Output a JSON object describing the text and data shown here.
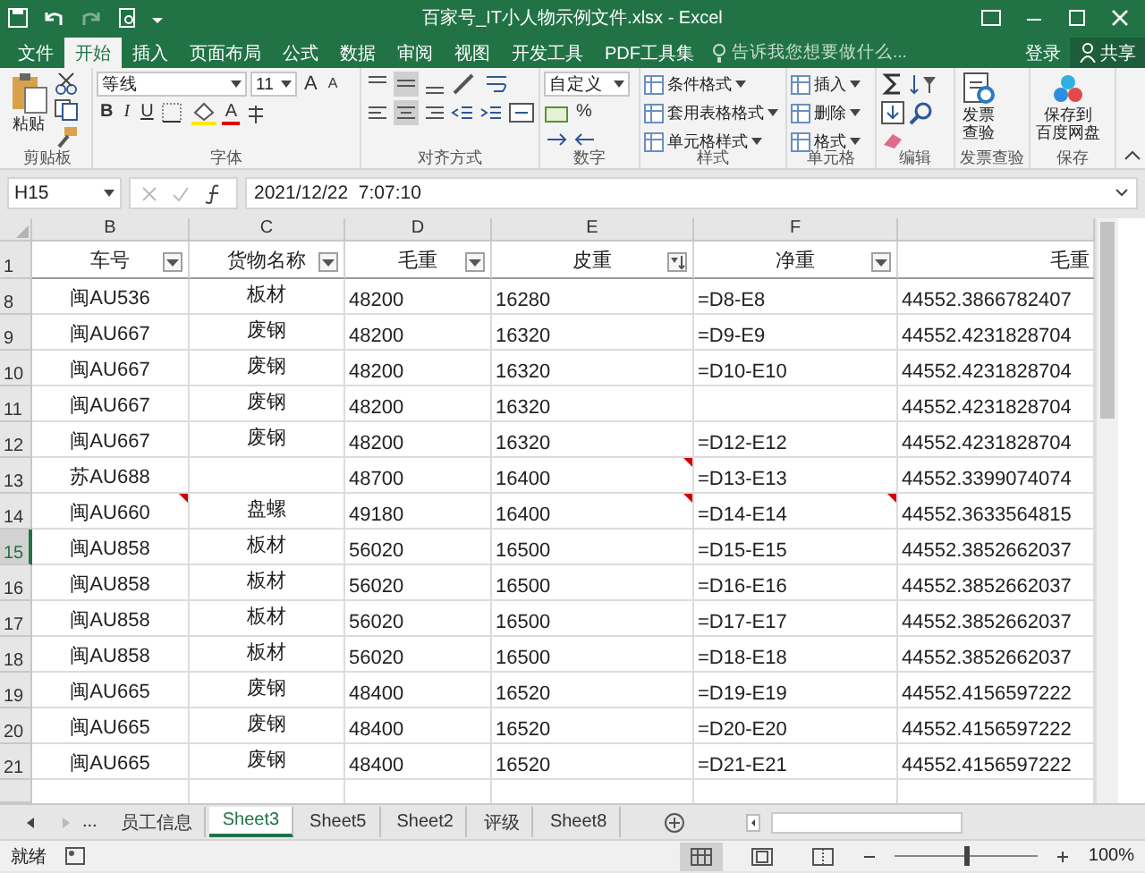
{
  "window": {
    "title": "百家号_IT小人物示例文件.xlsx - Excel"
  },
  "ribbon_tabs": [
    {
      "label": "文件",
      "selected": false
    },
    {
      "label": "开始",
      "selected": true
    },
    {
      "label": "插入",
      "selected": false
    },
    {
      "label": "页面布局",
      "selected": false
    },
    {
      "label": "公式",
      "selected": false
    },
    {
      "label": "数据",
      "selected": false
    },
    {
      "label": "审阅",
      "selected": false
    },
    {
      "label": "视图",
      "selected": false
    },
    {
      "label": "开发工具",
      "selected": false
    },
    {
      "label": "PDF工具集",
      "selected": false
    }
  ],
  "tell_me": {
    "placeholder": "告诉我您想要做什么..."
  },
  "sign_in": "登录",
  "share": "共享",
  "ribbon": {
    "groups": [
      {
        "kind": "clipboard",
        "label": "剪贴板",
        "paste": "粘贴"
      },
      {
        "kind": "font",
        "label": "字体",
        "font_name": "等线",
        "font_size": "11",
        "size_buttons": [
          "A",
          "A"
        ],
        "format_buttons": [
          "B",
          "I",
          "U"
        ],
        "font_color": "A"
      },
      {
        "kind": "align",
        "label": "对齐方式"
      },
      {
        "kind": "number",
        "label": "数字",
        "format": "自定义",
        "percent": "%"
      },
      {
        "kind": "commands",
        "label": "样式",
        "commands": [
          "条件格式",
          "套用表格格式",
          "单元格样式"
        ]
      },
      {
        "kind": "commands",
        "label": "单元格",
        "commands": [
          "插入",
          "删除",
          "格式"
        ]
      },
      {
        "kind": "editing",
        "label": "编辑"
      },
      {
        "kind": "big",
        "label": "发票查验",
        "lines": [
          "发票",
          "查验"
        ]
      },
      {
        "kind": "big",
        "label": "保存",
        "lines": [
          "保存到",
          "百度网盘"
        ]
      }
    ]
  },
  "formula_bar": {
    "name_box": "H15",
    "formula": "2021/12/22  7:07:10"
  },
  "header_row_number": "1",
  "columns": [
    {
      "letter": "B",
      "label": "车号",
      "filter_button": true,
      "sorted": false
    },
    {
      "letter": "C",
      "label": "货物名称",
      "filter_button": true,
      "sorted": false
    },
    {
      "letter": "D",
      "label": "毛重",
      "filter_button": true,
      "sorted": false
    },
    {
      "letter": "E",
      "label": "皮重",
      "filter_button": true,
      "sorted": true
    },
    {
      "letter": "F",
      "label": "净重",
      "filter_button": true,
      "sorted": false
    },
    {
      "label": "毛重",
      "filter_button": false
    }
  ],
  "rows": [
    {
      "number": "8",
      "selected": false,
      "cells": [
        {
          "text": "闽AU536",
          "comment": false
        },
        {
          "text": "板材",
          "comment": false
        },
        {
          "text": "48200",
          "comment": false
        },
        {
          "text": "16280",
          "comment": false
        },
        {
          "text": "=D8-E8",
          "comment": false
        },
        {
          "text": "44552.3866782407",
          "comment": false
        }
      ]
    },
    {
      "number": "9",
      "selected": false,
      "cells": [
        {
          "text": "闽AU667",
          "comment": false
        },
        {
          "text": "废钢",
          "comment": false
        },
        {
          "text": "48200",
          "comment": false
        },
        {
          "text": "16320",
          "comment": false
        },
        {
          "text": "=D9-E9",
          "comment": false
        },
        {
          "text": "44552.4231828704",
          "comment": false
        }
      ]
    },
    {
      "number": "10",
      "selected": false,
      "cells": [
        {
          "text": "闽AU667",
          "comment": false
        },
        {
          "text": "废钢",
          "comment": false
        },
        {
          "text": "48200",
          "comment": false
        },
        {
          "text": "16320",
          "comment": false
        },
        {
          "text": "=D10-E10",
          "comment": false
        },
        {
          "text": "44552.4231828704",
          "comment": false
        }
      ]
    },
    {
      "number": "11",
      "selected": false,
      "cells": [
        {
          "text": "闽AU667",
          "comment": false
        },
        {
          "text": "废钢",
          "comment": false
        },
        {
          "text": "48200",
          "comment": false
        },
        {
          "text": "16320",
          "comment": false
        },
        {
          "comment": false
        },
        {
          "text": "44552.4231828704",
          "comment": false
        }
      ]
    },
    {
      "number": "12",
      "selected": false,
      "cells": [
        {
          "text": "闽AU667",
          "comment": false
        },
        {
          "text": "废钢",
          "comment": false
        },
        {
          "text": "48200",
          "comment": false
        },
        {
          "text": "16320",
          "comment": false
        },
        {
          "text": "=D12-E12",
          "comment": false
        },
        {
          "text": "44552.4231828704",
          "comment": false
        }
      ]
    },
    {
      "number": "13",
      "selected": false,
      "cells": [
        {
          "text": "苏AU688",
          "comment": false
        },
        {
          "comment": false
        },
        {
          "text": "48700",
          "comment": false
        },
        {
          "text": "16400",
          "comment": true
        },
        {
          "text": "=D13-E13",
          "comment": false
        },
        {
          "text": "44552.3399074074",
          "comment": false
        }
      ]
    },
    {
      "number": "14",
      "selected": false,
      "cells": [
        {
          "text": "闽AU660",
          "comment": true
        },
        {
          "text": "盘螺",
          "comment": false
        },
        {
          "text": "49180",
          "comment": false
        },
        {
          "text": "16400",
          "comment": true
        },
        {
          "text": "=D14-E14",
          "comment": true
        },
        {
          "text": "44552.3633564815",
          "comment": false
        }
      ]
    },
    {
      "number": "15",
      "selected": true,
      "cells": [
        {
          "text": "闽AU858",
          "comment": false
        },
        {
          "text": "板材",
          "comment": false
        },
        {
          "text": "56020",
          "comment": false
        },
        {
          "text": "16500",
          "comment": false
        },
        {
          "text": "=D15-E15",
          "comment": false
        },
        {
          "text": "44552.3852662037",
          "comment": false
        }
      ]
    },
    {
      "number": "16",
      "selected": false,
      "cells": [
        {
          "text": "闽AU858",
          "comment": false
        },
        {
          "text": "板材",
          "comment": false
        },
        {
          "text": "56020",
          "comment": false
        },
        {
          "text": "16500",
          "comment": false
        },
        {
          "text": "=D16-E16",
          "comment": false
        },
        {
          "text": "44552.3852662037",
          "comment": false
        }
      ]
    },
    {
      "number": "17",
      "selected": false,
      "cells": [
        {
          "text": "闽AU858",
          "comment": false
        },
        {
          "text": "板材",
          "comment": false
        },
        {
          "text": "56020",
          "comment": false
        },
        {
          "text": "16500",
          "comment": false
        },
        {
          "text": "=D17-E17",
          "comment": false
        },
        {
          "text": "44552.3852662037",
          "comment": false
        }
      ]
    },
    {
      "number": "18",
      "selected": false,
      "cells": [
        {
          "text": "闽AU858",
          "comment": false
        },
        {
          "text": "板材",
          "comment": false
        },
        {
          "text": "56020",
          "comment": false
        },
        {
          "text": "16500",
          "comment": false
        },
        {
          "text": "=D18-E18",
          "comment": false
        },
        {
          "text": "44552.3852662037",
          "comment": false
        }
      ]
    },
    {
      "number": "19",
      "selected": false,
      "cells": [
        {
          "text": "闽AU665",
          "comment": false
        },
        {
          "text": "废钢",
          "comment": false
        },
        {
          "text": "48400",
          "comment": false
        },
        {
          "text": "16520",
          "comment": false
        },
        {
          "text": "=D19-E19",
          "comment": false
        },
        {
          "text": "44552.4156597222",
          "comment": false
        }
      ]
    },
    {
      "number": "20",
      "selected": false,
      "cells": [
        {
          "text": "闽AU665",
          "comment": false
        },
        {
          "text": "废钢",
          "comment": false
        },
        {
          "text": "48400",
          "comment": false
        },
        {
          "text": "16520",
          "comment": false
        },
        {
          "text": "=D20-E20",
          "comment": false
        },
        {
          "text": "44552.4156597222",
          "comment": false
        }
      ]
    },
    {
      "number": "21",
      "selected": false,
      "cells": [
        {
          "text": "闽AU665",
          "comment": false
        },
        {
          "text": "废钢",
          "comment": false
        },
        {
          "text": "48400",
          "comment": false
        },
        {
          "text": "16520",
          "comment": false
        },
        {
          "text": "=D21-E21",
          "comment": false
        },
        {
          "text": "44552.4156597222",
          "comment": false
        }
      ]
    }
  ],
  "sheet_tabs": {
    "overflow": "...",
    "tabs": [
      {
        "label": "员工信息",
        "selected": false
      },
      {
        "label": "Sheet3",
        "selected": true
      },
      {
        "label": "Sheet5",
        "selected": false
      },
      {
        "label": "Sheet2",
        "selected": false
      },
      {
        "label": "评级",
        "selected": false
      },
      {
        "label": "Sheet8",
        "selected": false
      }
    ]
  },
  "status_bar": {
    "status": "就绪",
    "views": [
      {
        "selected": true
      },
      {
        "selected": false
      },
      {
        "selected": false
      }
    ],
    "zoom": {
      "level": 0.5,
      "reading": "100%"
    }
  }
}
